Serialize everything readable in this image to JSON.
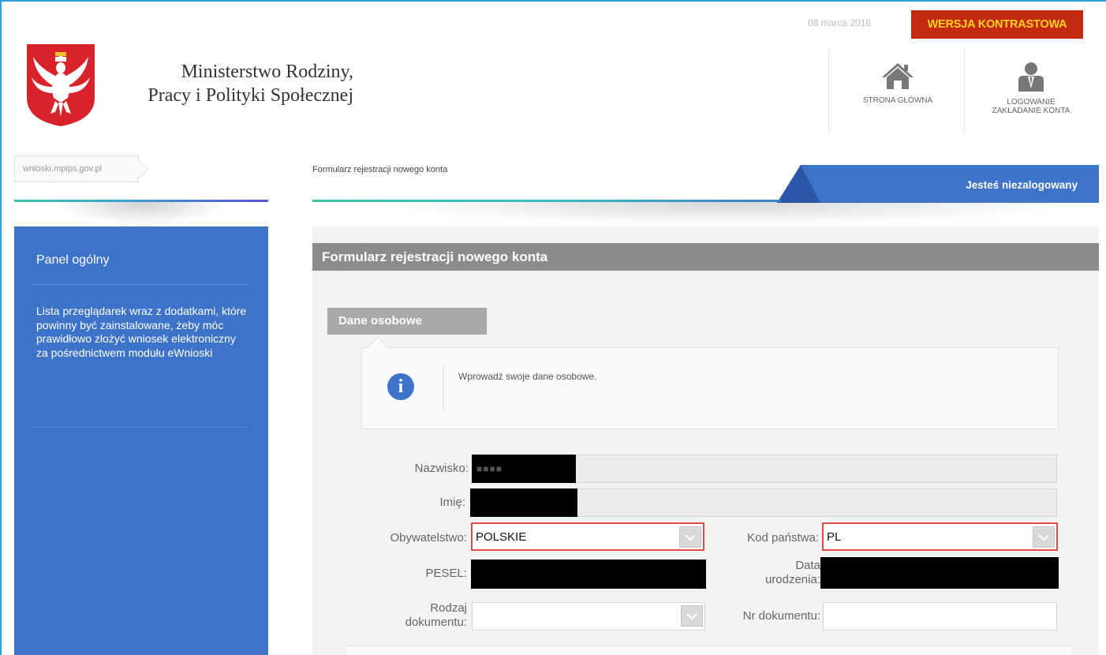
{
  "header": {
    "date": "08 marca 2016",
    "contrast_label": "WERSJA KONTRASTOWA",
    "ministry_line1": "Ministerstwo Rodziny,",
    "ministry_line2": "Pracy i Polityki Społecznej",
    "home_label": "STRONA GŁÓWNA",
    "login_line1": "LOGOWANIE",
    "login_line2": "ZAKŁADANIE KONTA"
  },
  "breadcrumbs": {
    "site": "wnioski.mpips.gov.pl",
    "current": "Formularz rejestracji nowego konta",
    "status": "Jesteś niezalogowany"
  },
  "sidebar": {
    "title": "Panel ogólny",
    "text": "Lista przeglądarek wraz z dodatkami, które powinny być zainstalowane, żeby móc prawidłowo złożyć wniosek elektroniczny za pośrednictwem modułu eWnioski"
  },
  "form": {
    "title": "Formularz rejestracji nowego konta",
    "section": "Dane osobowe",
    "info": "Wprowadź swoje dane osobowe.",
    "labels": {
      "surname": "Nazwisko:",
      "first_name": "Imię:",
      "citizenship": "Obywatelstwo:",
      "country_code": "Kod państwa:",
      "pesel": "PESEL:",
      "birth_date_1": "Data",
      "birth_date_2": "urodzenia:",
      "doc_type_1": "Rodzaj",
      "doc_type_2": "dokumentu:",
      "doc_number": "Nr dokumentu:"
    },
    "values": {
      "citizenship": "POLSKIE",
      "country_code": "PL",
      "doc_number": ""
    }
  },
  "colors": {
    "accent_blue": "#3d73c9",
    "contrast_bg": "#c42a10",
    "contrast_text": "#ffd21f",
    "error_border": "#e04a4a"
  }
}
